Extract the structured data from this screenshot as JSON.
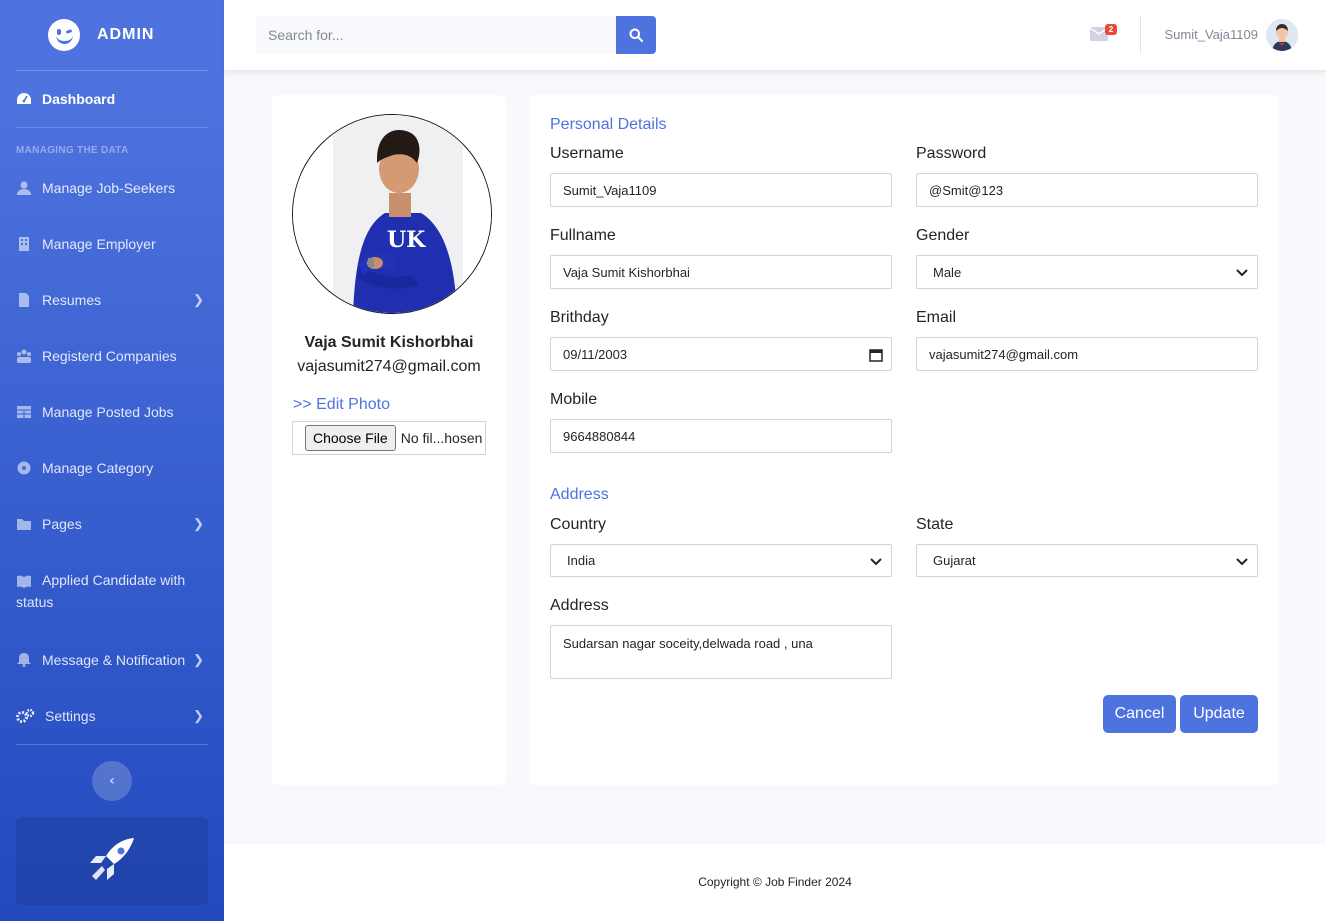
{
  "brand": {
    "name": "ADMIN"
  },
  "sidebar": {
    "heading": "MANAGING THE DATA",
    "items": [
      {
        "label": "Dashboard",
        "icon": "tachometer-icon",
        "active": true
      },
      {
        "label": "Manage Job-Seekers",
        "icon": "user-icon"
      },
      {
        "label": "Manage Employer",
        "icon": "building-icon"
      },
      {
        "label": "Resumes",
        "icon": "file-icon",
        "has_submenu": true
      },
      {
        "label": "Registerd Companies",
        "icon": "users-icon"
      },
      {
        "label": "Manage Posted Jobs",
        "icon": "table-icon"
      },
      {
        "label": "Manage Category",
        "icon": "circle-icon"
      },
      {
        "label": "Pages",
        "icon": "folder-icon",
        "has_submenu": true
      },
      {
        "label": "Applied Candidate with",
        "label_line2": "status",
        "icon": "book-icon"
      },
      {
        "label": "Message & Notification",
        "icon": "bell-icon",
        "has_submenu": true
      },
      {
        "label": "Settings",
        "icon": "cogs-icon",
        "has_submenu": true
      }
    ]
  },
  "topbar": {
    "search_placeholder": "Search for...",
    "message_count": "2",
    "user_name": "Sumit_Vaja1109"
  },
  "profile": {
    "full_name": "Vaja Sumit Kishorbhai",
    "email": "vajasumit274@gmail.com",
    "edit_photo_label": ">> Edit Photo",
    "file_button": "Choose File",
    "file_status": "No fil...hosen"
  },
  "form": {
    "personal_title": "Personal Details",
    "username_label": "Username",
    "username_value": "Sumit_Vaja1109",
    "password_label": "Password",
    "password_value": "@Smit@123",
    "fullname_label": "Fullname",
    "fullname_value": "Vaja Sumit Kishorbhai",
    "gender_label": "Gender",
    "gender_value": "Male",
    "birthday_label": "Brithday",
    "birthday_value": "09/11/2003",
    "email_label": "Email",
    "email_value": "vajasumit274@gmail.com",
    "mobile_label": "Mobile",
    "mobile_value": "9664880844",
    "address_title": "Address",
    "country_label": "Country",
    "country_value": "India",
    "state_label": "State",
    "state_value": "Gujarat",
    "address_label": "Address",
    "address_value": "Sudarsan nagar soceity,delwada road , una",
    "cancel_label": "Cancel",
    "update_label": "Update"
  },
  "footer": {
    "text": "Copyright © Job Finder 2024"
  },
  "colors": {
    "primary": "#4e73df",
    "sidebar_end": "#224abe",
    "danger": "#e74a3b"
  }
}
